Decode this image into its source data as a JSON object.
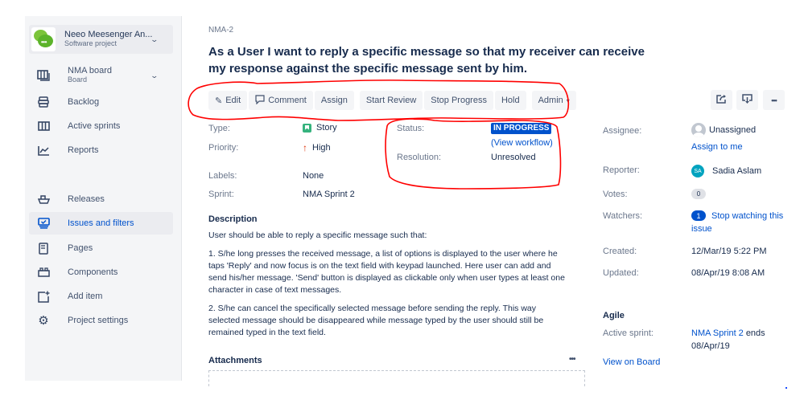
{
  "sidebar": {
    "project": {
      "name": "Neeo Meesenger An...",
      "type": "Software project",
      "icon": "project-logo-chat-bubbles"
    },
    "board": {
      "name": "NMA board",
      "type": "Board",
      "icon": "board-icon"
    },
    "items": [
      {
        "label": "Backlog",
        "icon": "backlog-icon"
      },
      {
        "label": "Active sprints",
        "icon": "active-sprints-icon"
      },
      {
        "label": "Reports",
        "icon": "reports-icon"
      },
      {
        "label": "Releases",
        "icon": "releases-icon"
      },
      {
        "label": "Issues and filters",
        "icon": "issues-icon",
        "active": true
      },
      {
        "label": "Pages",
        "icon": "pages-icon"
      },
      {
        "label": "Components",
        "icon": "components-icon"
      },
      {
        "label": "Add item",
        "icon": "add-item-icon"
      },
      {
        "label": "Project settings",
        "icon": "gear-icon"
      }
    ]
  },
  "issue": {
    "key": "NMA-2",
    "title": "As a User I want to reply a specific message so that my receiver can receive my response against the specific message sent by him."
  },
  "toolbar": {
    "edit": "Edit",
    "comment": "Comment",
    "assign": "Assign",
    "start_review": "Start Review",
    "stop_progress": "Stop Progress",
    "hold": "Hold",
    "admin": "Admin",
    "right_icons": [
      "share-icon",
      "export-icon",
      "more-icon"
    ]
  },
  "details": {
    "type_label": "Type:",
    "type_value": "Story",
    "priority_label": "Priority:",
    "priority_value": "High",
    "labels_label": "Labels:",
    "labels_value": "None",
    "sprint_label": "Sprint:",
    "sprint_value": "NMA Sprint 2",
    "status_label": "Status:",
    "status_value": "IN PROGRESS",
    "view_workflow": "(View workflow)",
    "resolution_label": "Resolution:",
    "resolution_value": "Unresolved"
  },
  "people": {
    "assignee_label": "Assignee:",
    "assignee_value": "Unassigned",
    "assign_to_me": "Assign to me",
    "reporter_label": "Reporter:",
    "reporter_initials": "SA",
    "reporter_value": "Sadia Aslam",
    "votes_label": "Votes:",
    "votes_value": "0",
    "watchers_label": "Watchers:",
    "watchers_value": "1",
    "stop_watching_1": "Stop watching this",
    "stop_watching_2": "issue"
  },
  "dates": {
    "created_label": "Created:",
    "created_value": "12/Mar/19 5:22 PM",
    "updated_label": "Updated:",
    "updated_value": "08/Apr/19 8:08 AM"
  },
  "agile": {
    "heading": "Agile",
    "active_sprint_label": "Active sprint:",
    "active_sprint_link": "NMA Sprint 2",
    "active_sprint_ends": "ends",
    "active_sprint_date": "08/Apr/19",
    "view_on_board": "View on Board"
  },
  "description": {
    "heading": "Description",
    "intro": "User should be able to reply a specific message such that:",
    "p1_lines": [
      "1. S/he long presses the received message, a list of options is displayed to the user where he",
      "taps 'Reply' and now focus is on the text field with keypad launched. Here user can add and",
      "send his/her message. 'Send' button is displayed as clickable only when user types at least one",
      "character in case of text messages."
    ],
    "p2_lines": [
      "2. S/he can cancel the specifically selected message before sending the reply. This way",
      "selected message should be disappeared while message typed by the user should still be",
      "remained typed in the text field."
    ]
  },
  "attachments": {
    "heading": "Attachments",
    "more": "•••"
  },
  "colors": {
    "accent": "#0052cc",
    "story": "#36b37e",
    "priority_high": "#de350b",
    "annotation": "#ff0000"
  }
}
